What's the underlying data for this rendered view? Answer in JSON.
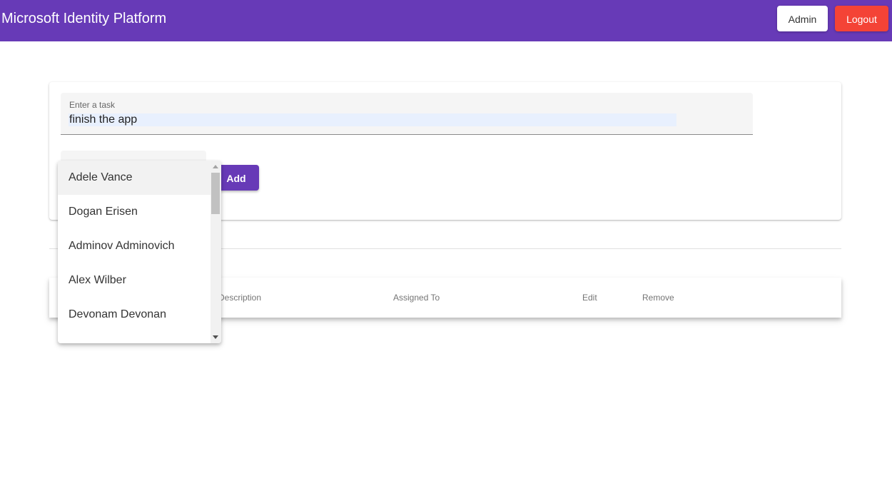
{
  "header": {
    "title": "Microsoft Identity Platform",
    "admin_label": "Admin",
    "logout_label": "Logout",
    "background_color": "#673ab7",
    "logout_color": "#f44336"
  },
  "form": {
    "task_label": "Enter a task",
    "task_value": "finish the app",
    "add_label": "Add"
  },
  "assignee_dropdown": {
    "options": [
      {
        "label": "Adele Vance",
        "active": true
      },
      {
        "label": "Dogan Erisen",
        "active": false
      },
      {
        "label": "Adminov Adminovich",
        "active": false
      },
      {
        "label": "Alex Wilber",
        "active": false
      },
      {
        "label": "Devonam Devonan",
        "active": false
      }
    ]
  },
  "table": {
    "columns": {
      "description": "Description",
      "assigned_to": "Assigned To",
      "edit": "Edit",
      "remove": "Remove"
    }
  }
}
